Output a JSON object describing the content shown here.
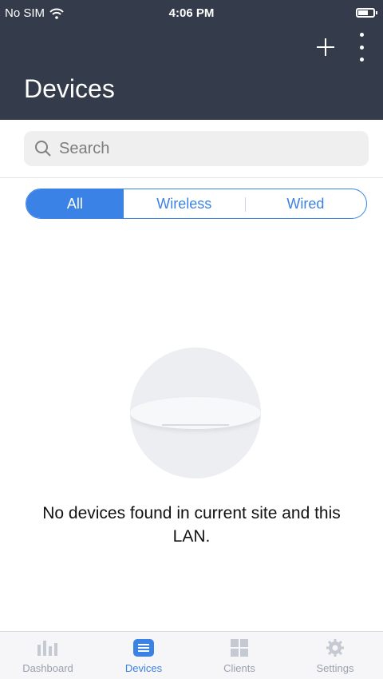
{
  "status_bar": {
    "carrier": "No SIM",
    "time": "4:06 PM"
  },
  "header": {
    "title": "Devices",
    "add_icon": "plus-icon",
    "more_icon": "kebab-icon"
  },
  "search": {
    "placeholder": "Search"
  },
  "filter": {
    "options": [
      "All",
      "Wireless",
      "Wired"
    ],
    "selected": "All"
  },
  "empty_state": {
    "message": "No devices found in current site and this LAN."
  },
  "tabs": [
    {
      "label": "Dashboard",
      "icon": "bar-chart-icon",
      "active": false
    },
    {
      "label": "Devices",
      "icon": "list-icon",
      "active": true
    },
    {
      "label": "Clients",
      "icon": "grid-icon",
      "active": false
    },
    {
      "label": "Settings",
      "icon": "gear-icon",
      "active": false
    }
  ],
  "colors": {
    "header_bg": "#343b4a",
    "accent": "#3b82e6"
  }
}
